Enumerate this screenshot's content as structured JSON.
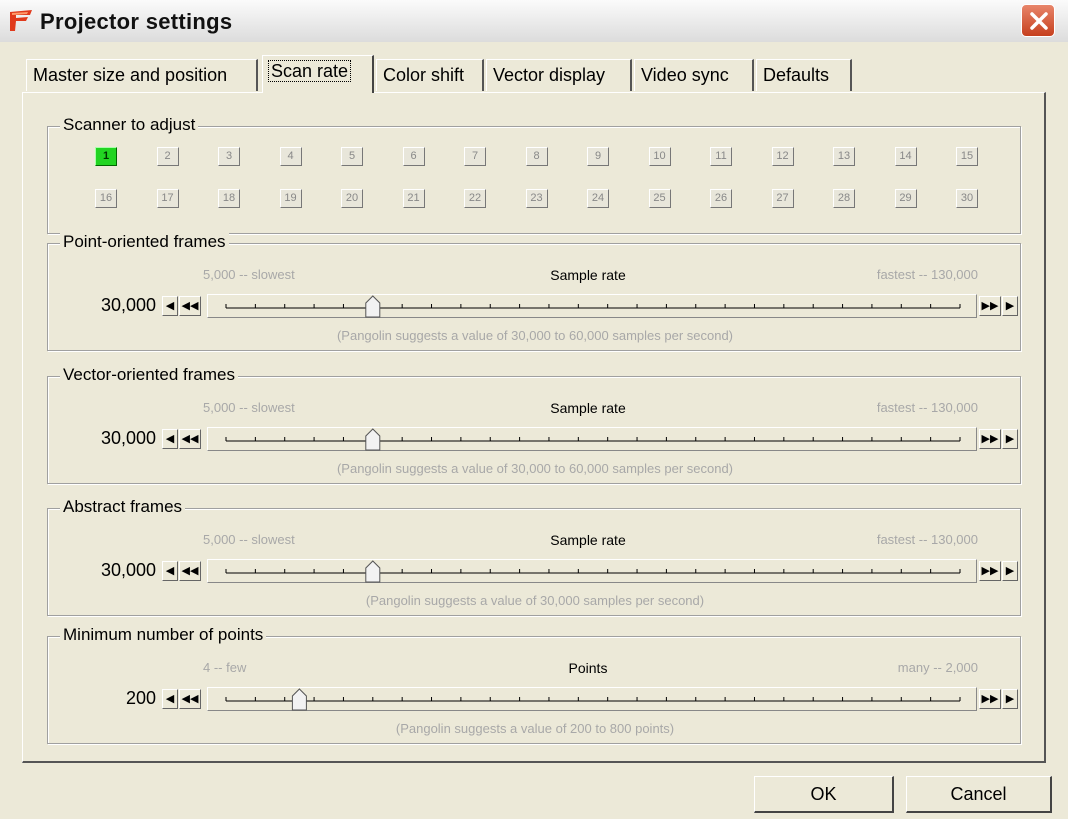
{
  "window": {
    "title": "Projector settings",
    "close_icon": "close-icon",
    "app_icon": "pangolin-app-icon"
  },
  "tabs": [
    {
      "label": "Master size and position",
      "active": false
    },
    {
      "label": "Scan rate",
      "active": true
    },
    {
      "label": "Color shift",
      "active": false
    },
    {
      "label": "Vector display",
      "active": false
    },
    {
      "label": "Video sync",
      "active": false
    },
    {
      "label": "Defaults",
      "active": false
    }
  ],
  "scanner_group": {
    "title": "Scanner to adjust",
    "selected": "1",
    "buttons": [
      "1",
      "2",
      "3",
      "4",
      "5",
      "6",
      "7",
      "8",
      "9",
      "10",
      "11",
      "12",
      "13",
      "14",
      "15",
      "16",
      "17",
      "18",
      "19",
      "20",
      "21",
      "22",
      "23",
      "24",
      "25",
      "26",
      "27",
      "28",
      "29",
      "30"
    ]
  },
  "sliders": [
    {
      "title": "Point-oriented frames",
      "value": "30,000",
      "left_hint": "5,000 -- slowest",
      "center_label": "Sample rate",
      "right_hint": "fastest -- 130,000",
      "suggestion": "(Pangolin suggests a value of 30,000 to 60,000 samples per second)",
      "position": 0.2
    },
    {
      "title": "Vector-oriented frames",
      "value": "30,000",
      "left_hint": "5,000 -- slowest",
      "center_label": "Sample rate",
      "right_hint": "fastest -- 130,000",
      "suggestion": "(Pangolin suggests a value of 30,000 to 60,000 samples per second)",
      "position": 0.2
    },
    {
      "title": "Abstract frames",
      "value": "30,000",
      "left_hint": "5,000 -- slowest",
      "center_label": "Sample rate",
      "right_hint": "fastest -- 130,000",
      "suggestion": "(Pangolin suggests a value of 30,000 samples per second)",
      "position": 0.2
    },
    {
      "title": "Minimum number of points",
      "value": "200",
      "left_hint": "4 -- few",
      "center_label": "Points",
      "right_hint": "many -- 2,000",
      "suggestion": "(Pangolin suggests a value of 200 to 800 points)",
      "position": 0.1
    }
  ],
  "slider_buttons": {
    "step_left": "◀",
    "jump_left": "◀◀",
    "jump_right": "▶▶",
    "step_right": "▶"
  },
  "buttons": {
    "ok": "OK",
    "cancel": "Cancel"
  },
  "colors": {
    "selected_scanner": "#22d422",
    "close_button": "#d4532c"
  }
}
